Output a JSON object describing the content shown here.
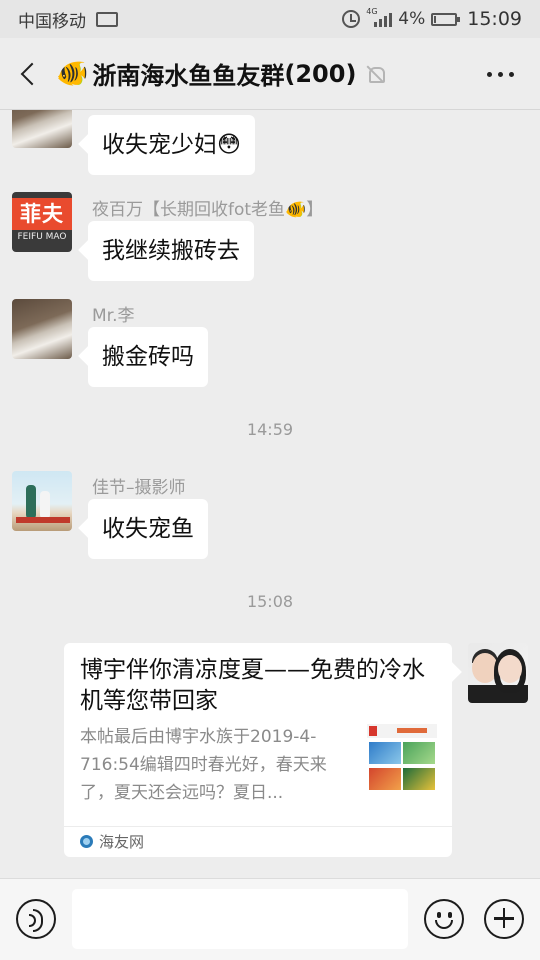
{
  "status_bar": {
    "carrier": "中国移动",
    "battery_percent": "4%",
    "time": "15:09",
    "network_label": "4G"
  },
  "header": {
    "title_emoji": "🐠",
    "group_name": "浙南海水鱼鱼友群",
    "member_count": "(200)",
    "muted_icon": "mute-bell-icon",
    "more_icon": "more-dots-icon"
  },
  "messages": [
    {
      "type": "text",
      "sender": "",
      "avatar": "husky-dog",
      "text": "收失宠少妇",
      "emoji": "😳"
    },
    {
      "type": "text",
      "sender": "夜百万【长期回收fot老鱼🐠】",
      "avatar": "feifu-logo",
      "text": "我继续搬砖去"
    },
    {
      "type": "text",
      "sender": "Mr.李",
      "avatar": "husky-dog",
      "text": "搬金砖吗"
    },
    {
      "type": "time",
      "text": "14:59"
    },
    {
      "type": "text",
      "sender": "佳节–摄影师",
      "avatar": "beach-photo",
      "text": "收失宠鱼"
    },
    {
      "type": "time",
      "text": "15:08"
    },
    {
      "type": "link",
      "avatar": "couple-photo",
      "title": "博宇伴你清凉度夏——免费的冷水机等您带回家",
      "description": "本帖最后由博宇水族于2019-4-716:54编辑四时春光好，春天来了，夏天还会远吗？夏日...",
      "source": "海友网"
    }
  ],
  "avatar_text": {
    "feifu_top": "菲夫",
    "feifu_bottom": "FEIFU MAO"
  },
  "input_bar": {
    "placeholder": "",
    "voice_icon": "voice-icon",
    "emoji_icon": "emoji-icon",
    "plus_icon": "plus-icon"
  },
  "colors": {
    "background": "#ededed",
    "bubble": "#ffffff",
    "timestamp": "#9a9a9a",
    "feifu_red": "#e94b2e"
  }
}
